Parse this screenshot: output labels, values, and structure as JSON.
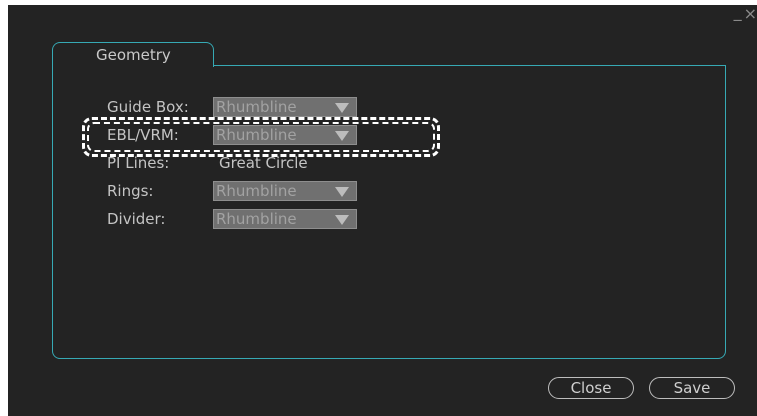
{
  "window": {
    "controls": {
      "minimize_glyph": "_",
      "close_glyph": "×"
    }
  },
  "tab": {
    "label": "Geometry"
  },
  "rows": [
    {
      "label": "Guide Box:",
      "value": "Rhumbline"
    },
    {
      "label": "EBL/VRM:",
      "value": "Rhumbline"
    },
    {
      "label": "PI Lines:",
      "value": "Great Circle"
    },
    {
      "label": "Rings:",
      "value": "Rhumbline"
    },
    {
      "label": "Divider:",
      "value": "Rhumbline"
    }
  ],
  "buttons": {
    "close": "Close",
    "save": "Save"
  },
  "colors": {
    "background": "#232323",
    "panel_border": "#36a9b4",
    "select_bg": "#707070",
    "highlight": "#ffffff"
  }
}
